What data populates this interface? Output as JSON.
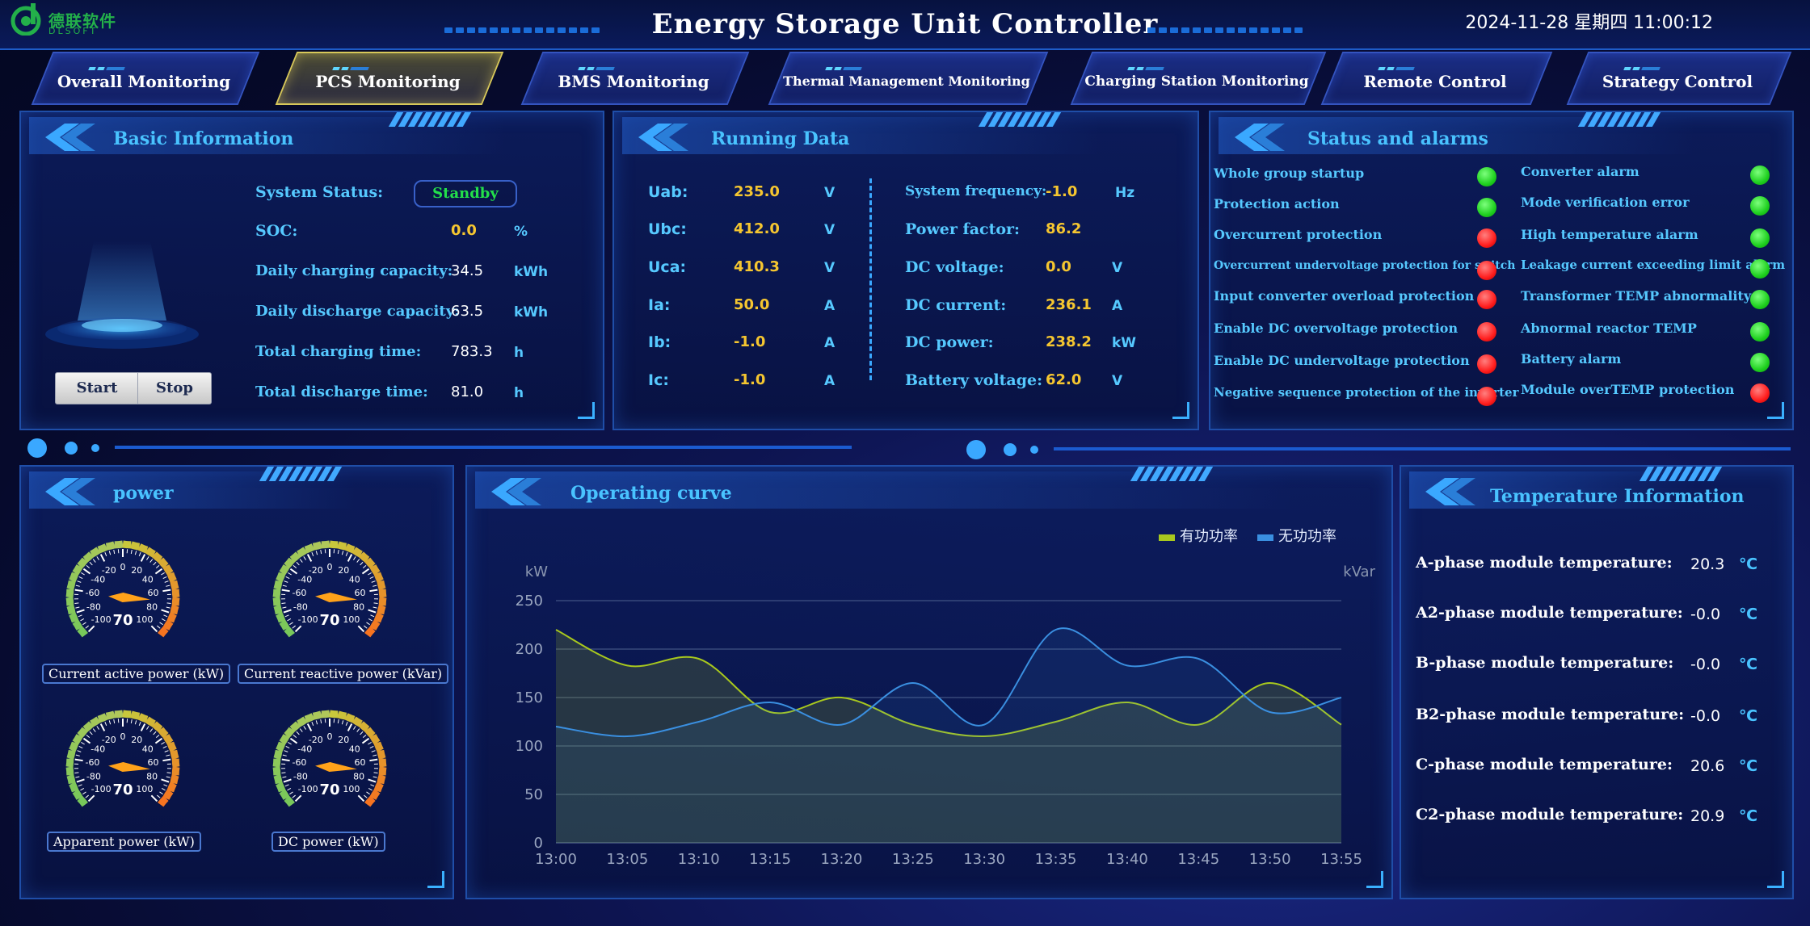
{
  "header": {
    "logo_cn": "德联软件",
    "logo_en": "DLSOFT",
    "title": "Energy Storage Unit Controller",
    "datetime": "2024-11-28 星期四 11:00:12"
  },
  "nav": {
    "tabs": [
      {
        "label": "Overall Monitoring",
        "active": false
      },
      {
        "label": "PCS Monitoring",
        "active": true
      },
      {
        "label": "BMS Monitoring",
        "active": false
      },
      {
        "label": "Thermal Management Monitoring",
        "active": false
      },
      {
        "label": "Charging Station Monitoring",
        "active": false
      },
      {
        "label": "Remote Control",
        "active": false
      },
      {
        "label": "Strategy Control",
        "active": false
      }
    ]
  },
  "basic": {
    "title": "Basic Information",
    "system_status_label": "System Status:",
    "system_status": "Standby",
    "rows": [
      {
        "label": "SOC:",
        "value": "0.0",
        "unit": "%"
      },
      {
        "label": "Daily charging capacity:",
        "value": "34.5",
        "unit": "kWh"
      },
      {
        "label": "Daily discharge capacity:",
        "value": "63.5",
        "unit": "kWh"
      },
      {
        "label": "Total charging time:",
        "value": "783.3",
        "unit": "h"
      },
      {
        "label": "Total discharge time:",
        "value": "81.0",
        "unit": "h"
      }
    ],
    "start_label": "Start",
    "stop_label": "Stop"
  },
  "running": {
    "title": "Running Data",
    "left": [
      {
        "label": "Uab:",
        "value": "235.0",
        "unit": "V"
      },
      {
        "label": "Ubc:",
        "value": "412.0",
        "unit": "V"
      },
      {
        "label": "Uca:",
        "value": "410.3",
        "unit": "V"
      },
      {
        "label": "Ia:",
        "value": "50.0",
        "unit": "A"
      },
      {
        "label": "Ib:",
        "value": "-1.0",
        "unit": "A"
      },
      {
        "label": "Ic:",
        "value": "-1.0",
        "unit": "A"
      }
    ],
    "right": [
      {
        "label": "System frequency:",
        "value": "-1.0",
        "unit": "Hz"
      },
      {
        "label": "Power factor:",
        "value": "86.2",
        "unit": ""
      },
      {
        "label": "DC voltage:",
        "value": "0.0",
        "unit": "V"
      },
      {
        "label": "DC current:",
        "value": "236.1",
        "unit": "A"
      },
      {
        "label": "DC power:",
        "value": "238.2",
        "unit": "kW"
      },
      {
        "label": "Battery voltage:",
        "value": "62.0",
        "unit": "V"
      }
    ]
  },
  "alarms": {
    "title": "Status and alarms",
    "left": [
      {
        "label": "Whole group startup",
        "state": "green"
      },
      {
        "label": "Protection action",
        "state": "green"
      },
      {
        "label": "Overcurrent protection",
        "state": "red"
      },
      {
        "label": "Overcurrent undervoltage protection for switch",
        "state": "red"
      },
      {
        "label": "Input converter overload protection",
        "state": "red"
      },
      {
        "label": "Enable DC overvoltage protection",
        "state": "red"
      },
      {
        "label": "Enable DC undervoltage protection",
        "state": "red"
      },
      {
        "label": "Negative sequence protection of the inverter",
        "state": "red"
      }
    ],
    "right": [
      {
        "label": "Converter alarm",
        "state": "green"
      },
      {
        "label": "Mode verification error",
        "state": "green"
      },
      {
        "label": "High temperature alarm",
        "state": "green"
      },
      {
        "label": "Leakage current exceeding limit alarm",
        "state": "green"
      },
      {
        "label": "Transformer TEMP abnormality",
        "state": "green"
      },
      {
        "label": "Abnormal reactor TEMP",
        "state": "green"
      },
      {
        "label": "Battery alarm",
        "state": "green"
      },
      {
        "label": "Module overTEMP protection",
        "state": "red"
      }
    ]
  },
  "power": {
    "title": "power",
    "gauges": [
      {
        "caption": "Current active power (kW)",
        "value": "70"
      },
      {
        "caption": "Current reactive power (kVar)",
        "value": "70"
      },
      {
        "caption": "Apparent power (kW)",
        "value": "70"
      },
      {
        "caption": "DC power (kW)",
        "value": "70"
      }
    ],
    "gauge_ticks": [
      "-100",
      "-80",
      "-60",
      "-40",
      "-20",
      "0",
      "20",
      "40",
      "60",
      "80",
      "100"
    ]
  },
  "curve": {
    "title": "Operating curve"
  },
  "chart_data": {
    "type": "line",
    "title": "",
    "x": [
      "13:00",
      "13:05",
      "13:10",
      "13:15",
      "13:20",
      "13:25",
      "13:30",
      "13:35",
      "13:40",
      "13:45",
      "13:50",
      "13:55"
    ],
    "y_left_label": "kW",
    "y_right_label": "kVar",
    "ylim": [
      0,
      250
    ],
    "yticks": [
      0,
      50,
      100,
      150,
      200,
      250
    ],
    "grid": true,
    "legend_position": "top-right",
    "series": [
      {
        "name": "有功功率",
        "color": "#a8c81e",
        "values": [
          220,
          183,
          190,
          135,
          150,
          122,
          110,
          125,
          145,
          122,
          165,
          122
        ]
      },
      {
        "name": "无功功率",
        "color": "#3a8fe0",
        "values": [
          120,
          110,
          125,
          145,
          122,
          165,
          122,
          220,
          183,
          190,
          135,
          150
        ]
      }
    ]
  },
  "temps": {
    "title": "Temperature Information",
    "rows": [
      {
        "label": "A-phase module temperature:",
        "value": "20.3",
        "unit": "℃"
      },
      {
        "label": "A2-phase module temperature:",
        "value": "-0.0",
        "unit": "℃"
      },
      {
        "label": "B-phase module temperature:",
        "value": "-0.0",
        "unit": "℃"
      },
      {
        "label": "B2-phase module temperature:",
        "value": "-0.0",
        "unit": "℃"
      },
      {
        "label": "C-phase module temperature:",
        "value": "20.6",
        "unit": "℃"
      },
      {
        "label": "C2-phase module temperature:",
        "value": "20.9",
        "unit": "℃"
      }
    ]
  }
}
